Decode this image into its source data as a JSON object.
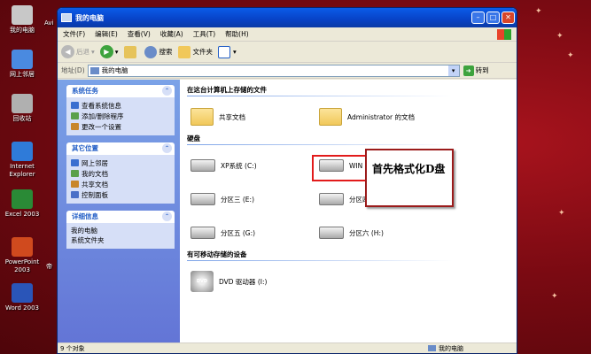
{
  "desktop": {
    "icons": [
      {
        "label": "我的电脑",
        "color": "#c8c8c8"
      },
      {
        "label": "网上邻居",
        "color": "#4a8ae0"
      },
      {
        "label": "回收站",
        "color": "#b0b0b0"
      },
      {
        "label": "Internet Explorer",
        "color": "#2f7bd9"
      },
      {
        "label": "Excel 2003",
        "color": "#2a8a36"
      },
      {
        "label": "PowerPoint 2003",
        "color": "#d04a1e"
      },
      {
        "label": "Word 2003",
        "color": "#2a55b8"
      }
    ],
    "partial_labels": [
      "Avi",
      "帝"
    ]
  },
  "window": {
    "title": "我的电脑",
    "menu": [
      "文件(F)",
      "编辑(E)",
      "查看(V)",
      "收藏(A)",
      "工具(T)",
      "帮助(H)"
    ],
    "toolbar": {
      "back": "后退",
      "search": "搜索",
      "folders": "文件夹"
    },
    "address": {
      "label": "地址(D)",
      "value": "我的电脑",
      "go": "转到"
    },
    "left_panels": [
      {
        "title": "系统任务",
        "items": [
          "查看系统信息",
          "添加/删除程序",
          "更改一个设置"
        ]
      },
      {
        "title": "其它位置",
        "items": [
          "网上邻居",
          "我的文档",
          "共享文档",
          "控制面板"
        ]
      },
      {
        "title": "详细信息",
        "items": [
          "我的电脑",
          "系统文件夹"
        ]
      }
    ],
    "sections": {
      "stored": {
        "title": "在这台计算机上存储的文件",
        "items": [
          "共享文档",
          "Administrator 的文档"
        ]
      },
      "hdd": {
        "title": "硬盘",
        "items": [
          "XP系统 (C:)",
          "WIN 7系统 (D:)",
          "分区三 (E:)",
          "分区四 (F:)",
          "分区五 (G:)",
          "分区六 (H:)"
        ]
      },
      "removable": {
        "title": "有可移动存储的设备",
        "items": [
          "DVD 驱动器 (I:)"
        ],
        "dvd_badge": "DVD"
      }
    },
    "callout": "首先格式化D盘",
    "status": {
      "left": "9 个对象",
      "right": "我的电脑"
    }
  }
}
